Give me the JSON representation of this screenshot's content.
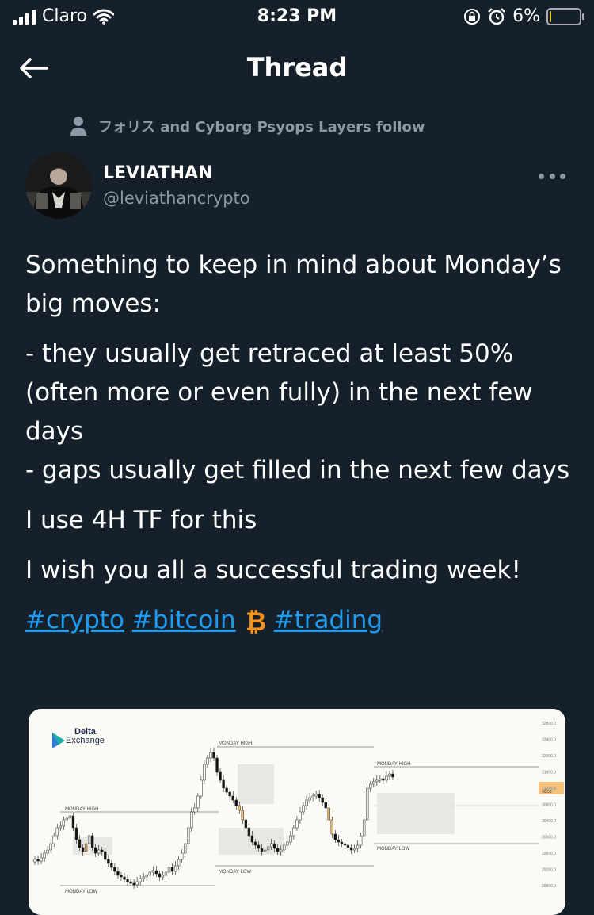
{
  "status_bar": {
    "carrier": "Claro",
    "time": "8:23 PM",
    "battery_percent": "6%",
    "battery_level": 0.06
  },
  "header": {
    "title": "Thread"
  },
  "social_context": {
    "text": "フォリス and Cyborg Psyops Layers follow"
  },
  "author": {
    "name": "LEVIATHAN",
    "handle": "@leviathancrypto"
  },
  "tweet": {
    "paragraphs": [
      "Something to keep in mind about Monday’s big moves:",
      "- they usually get retraced at least 50% (often more or even fully) in the next few days",
      "- gaps usually get filled in the next few days",
      "I use 4H TF for this",
      "I wish you all a successful trading week!"
    ],
    "hashtags": [
      "#crypto",
      "#bitcoin",
      "#trading"
    ]
  },
  "media": {
    "logo_name": "Delta.",
    "logo_sub": "Exchange",
    "labels": {
      "mh1": "MONDAY HIGH",
      "mh2": "MONDAY HIGH",
      "mh3": "MONDAY HIGH",
      "ml1": "MONDAY LOW",
      "ml2": "MONDAY LOW",
      "ml3": "MONDAY LOW"
    },
    "price_axis": [
      "32800.0",
      "32400.0",
      "32000.0",
      "31600.0",
      "31249.8",
      "30800.0",
      "30400.0",
      "30000.0",
      "29600.0",
      "29200.0",
      "28800.0"
    ],
    "current_price": "31249.8",
    "current_sub": "40:08",
    "colors": {
      "up": "#ffffff",
      "down": "#111111",
      "highlight": "#f0c27a",
      "current_tag": "#f5c27d"
    }
  }
}
